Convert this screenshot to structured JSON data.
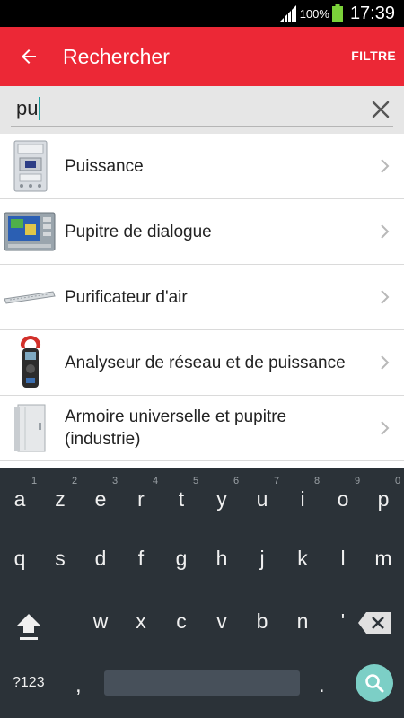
{
  "status_bar": {
    "battery_percent": "100%",
    "time": "17:39"
  },
  "app_bar": {
    "title": "Rechercher",
    "filter_label": "FILTRE",
    "color": "#ec2836"
  },
  "search": {
    "value": "pu"
  },
  "results": [
    {
      "label": "Puissance",
      "thumb": "circuit-breaker"
    },
    {
      "label": "Pupitre de dialogue",
      "thumb": "touch-panel"
    },
    {
      "label": "Purificateur d'air",
      "thumb": "air-purifier"
    },
    {
      "label": "Analyseur de réseau et de puissance",
      "thumb": "clamp-meter"
    },
    {
      "label": "Armoire universelle et pupitre (industrie)",
      "thumb": "cabinet"
    }
  ],
  "keyboard": {
    "row1": [
      {
        "key": "a",
        "hint": "1"
      },
      {
        "key": "z",
        "hint": "2"
      },
      {
        "key": "e",
        "hint": "3"
      },
      {
        "key": "r",
        "hint": "4"
      },
      {
        "key": "t",
        "hint": "5"
      },
      {
        "key": "y",
        "hint": "6"
      },
      {
        "key": "u",
        "hint": "7"
      },
      {
        "key": "i",
        "hint": "8"
      },
      {
        "key": "o",
        "hint": "9"
      },
      {
        "key": "p",
        "hint": "0"
      }
    ],
    "row2": [
      "q",
      "s",
      "d",
      "f",
      "g",
      "h",
      "j",
      "k",
      "l",
      "m"
    ],
    "row3": [
      "w",
      "x",
      "c",
      "v",
      "b",
      "n",
      "'"
    ],
    "symbols_label": "?123",
    "comma": ",",
    "period": ".",
    "accent_color": "#7ccfc6"
  }
}
